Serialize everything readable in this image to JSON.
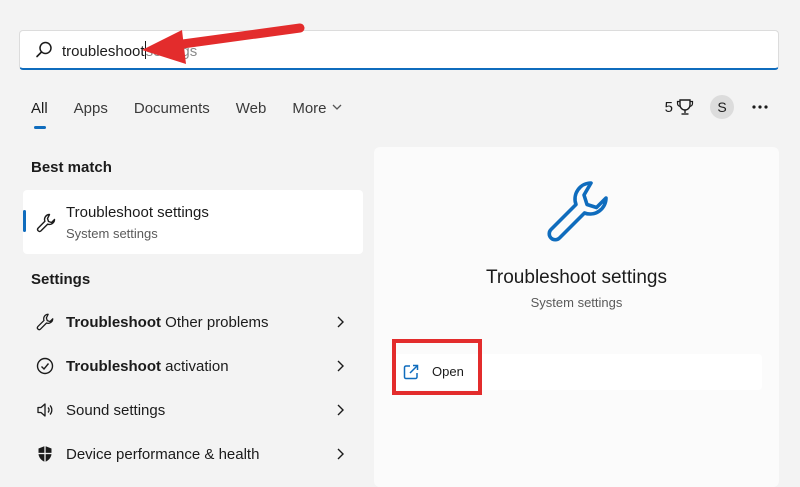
{
  "search": {
    "typed": "troubleshoot",
    "suggestion": "settings"
  },
  "tabs": [
    {
      "label": "All",
      "active": true
    },
    {
      "label": "Apps"
    },
    {
      "label": "Documents"
    },
    {
      "label": "Web"
    },
    {
      "label": "More"
    }
  ],
  "toolbar": {
    "points": "5",
    "avatar_initial": "S"
  },
  "best_match": {
    "section_label": "Best match",
    "title": "Troubleshoot settings",
    "subtitle": "System settings"
  },
  "settings": {
    "section_label": "Settings",
    "items": [
      {
        "bold": "Troubleshoot",
        "rest": " Other problems",
        "icon": "wrench-icon"
      },
      {
        "bold": "Troubleshoot",
        "rest": " activation",
        "icon": "check-circle-icon"
      },
      {
        "bold": "",
        "rest": "Sound settings",
        "icon": "speaker-icon"
      },
      {
        "bold": "",
        "rest": "Device performance & health",
        "icon": "shield-icon"
      }
    ]
  },
  "preview": {
    "title": "Troubleshoot settings",
    "subtitle": "System settings",
    "open_label": "Open"
  },
  "colors": {
    "accent": "#0f6cbd",
    "annotation_red": "#e32c2c"
  }
}
